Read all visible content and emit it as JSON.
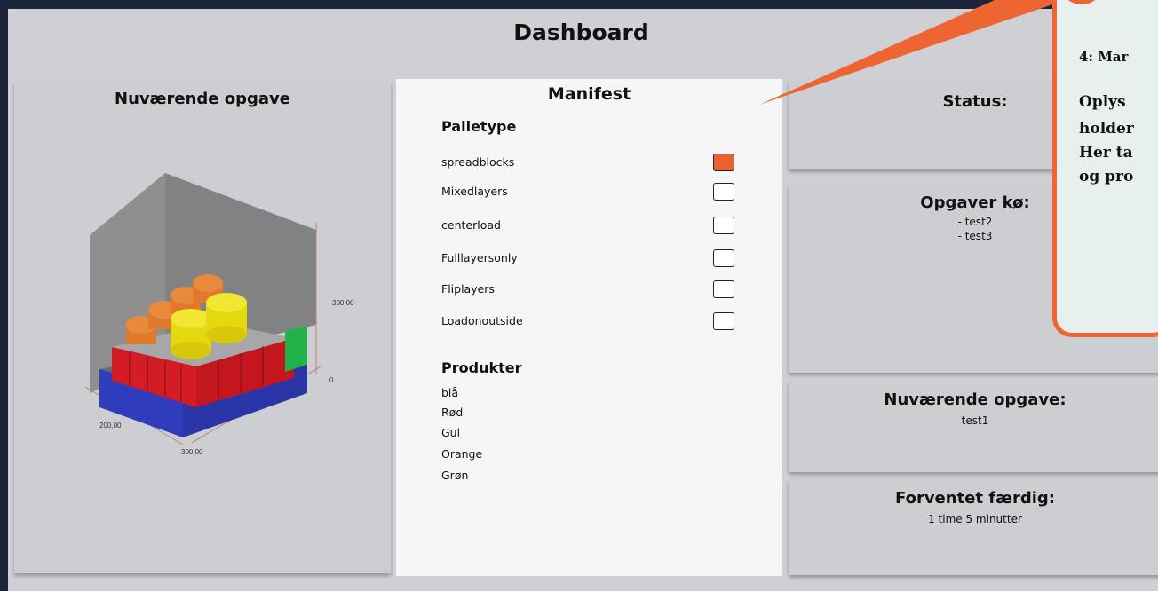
{
  "header": {
    "title": "Dashboard"
  },
  "left_panel": {
    "title": "Nuværende opgave",
    "axis_labels": {
      "z_top": "300,00",
      "z_zero": "0",
      "x_label": "200,00",
      "y_label": "300,00"
    }
  },
  "manifest": {
    "title": "Manifest",
    "palletype_heading": "Palletype",
    "options": [
      {
        "label": "spreadblocks",
        "checked": true
      },
      {
        "label": "Mixedlayers",
        "checked": false
      },
      {
        "label": "centerload",
        "checked": false
      },
      {
        "label": "Fulllayersonly",
        "checked": false
      },
      {
        "label": "Fliplayers",
        "checked": false
      },
      {
        "label": "Loadonoutside",
        "checked": false
      }
    ],
    "produkter_heading": "Produkter",
    "products": [
      "blå",
      "Rød",
      "Gul",
      "Orange",
      "Grøn"
    ]
  },
  "status": {
    "title": "Status:"
  },
  "queue": {
    "title": "Opgaver kø:",
    "items": [
      "- test2",
      "- test3"
    ]
  },
  "current": {
    "title": "Nuværende opgave:",
    "value": "test1"
  },
  "eta": {
    "title": "Forventet færdig:",
    "value": "1 time 5 minutter"
  },
  "callout": {
    "heading": "4: Mar",
    "lines": [
      "Oplys",
      "holder",
      "Her ta",
      "og pro"
    ]
  },
  "colors": {
    "accent": "#ec6131",
    "blue": "#2f3dbd",
    "red": "#d41c24",
    "yellow": "#e8dc10",
    "orange": "#e07a2a",
    "green": "#22b24a"
  }
}
